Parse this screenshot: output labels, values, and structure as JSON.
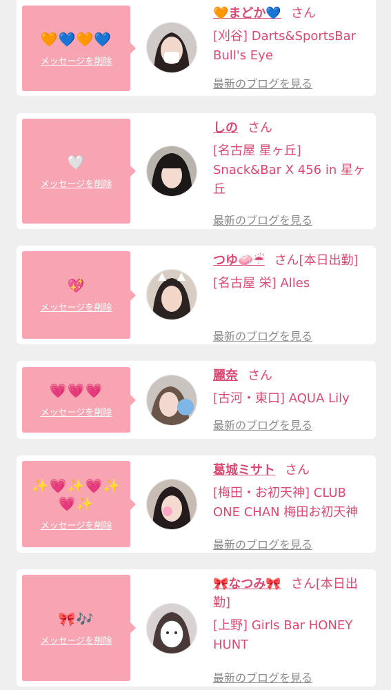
{
  "delete_label": "メッセージを削除",
  "blog_link_label": "最新のブログを見る",
  "san_suffix": "さん",
  "accent_color": "#d94a72",
  "box_color": "#f7a5b3",
  "cards": [
    {
      "emoji": "🧡💙🧡💙",
      "name": "🧡まどか💙",
      "san": "さん",
      "store": "[刈谷] Darts&SportsBar Bull's Eye"
    },
    {
      "emoji": "🤍",
      "name": "しの",
      "san": "さん",
      "store": "[名古屋 星ヶ丘] Snack&Bar X 456 in 星ヶ丘"
    },
    {
      "emoji": "💖",
      "name": "つゆ🧼☔",
      "san": "さん[本日出勤]",
      "store": "[名古屋 栄] Alles"
    },
    {
      "emoji": "💗💗💗",
      "name": "麗奈",
      "san": "さん",
      "store": "[古河・東口] AQUA Lily"
    },
    {
      "emoji": "✨💗✨💗✨💗✨",
      "name": "葛城ミサト",
      "san": "さん",
      "store": "[梅田・お初天神] CLUB ONE CHAN 梅田お初天神"
    },
    {
      "emoji": "🎀🎶",
      "name": "🎀なつみ🎀",
      "san": "さん[本日出勤]",
      "store": "[上野] Girls Bar HONEY HUNT"
    }
  ]
}
